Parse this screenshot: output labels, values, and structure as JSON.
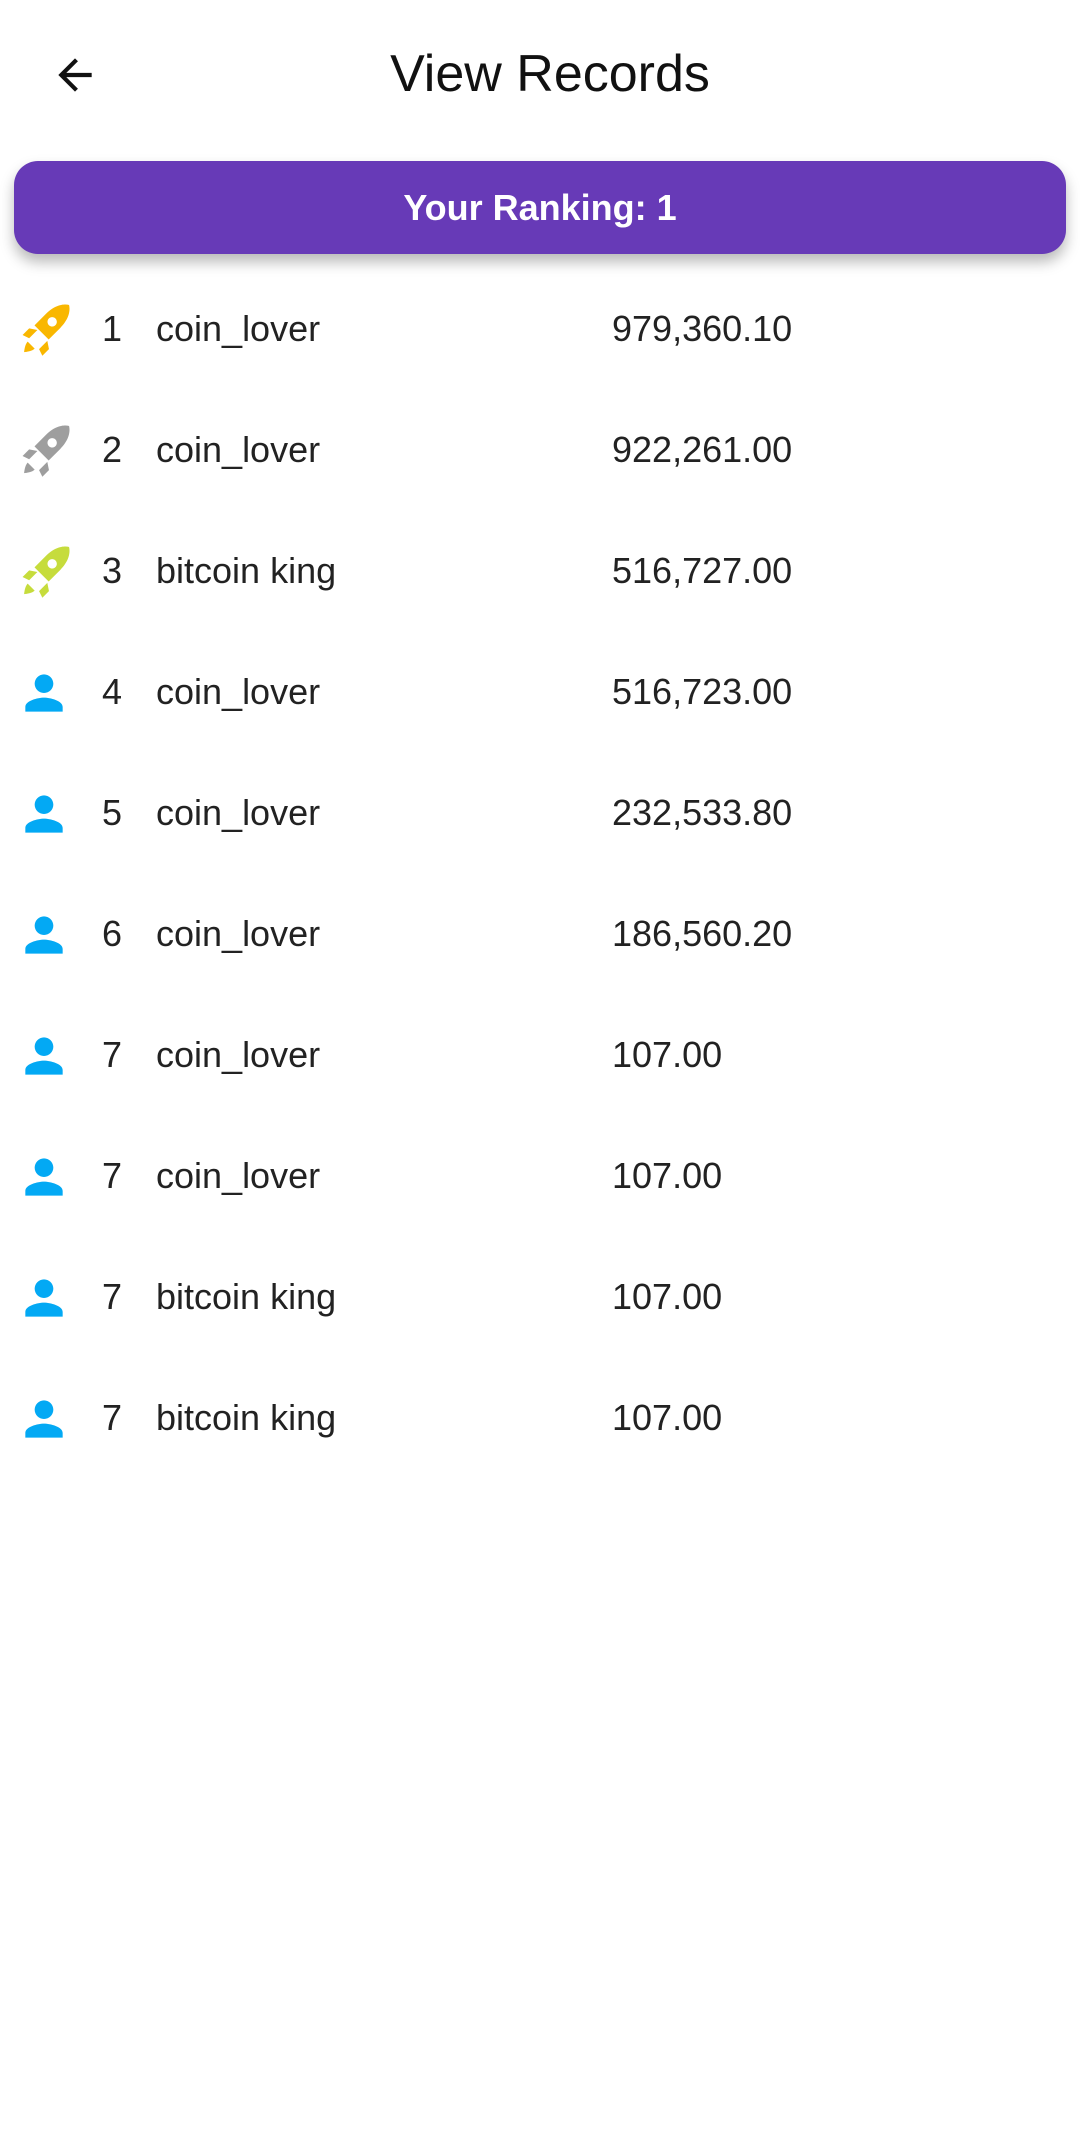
{
  "header": {
    "title": "View Records",
    "back_icon": "arrow-left-icon"
  },
  "ranking_banner": {
    "text": "Your Ranking: 1",
    "color": "#673ab7"
  },
  "records": [
    {
      "rank": "1",
      "name": "coin_lover",
      "score": "979,360.10",
      "icon": "rocket-icon",
      "icon_color": "#f9b700"
    },
    {
      "rank": "2",
      "name": "coin_lover",
      "score": "922,261.00",
      "icon": "rocket-icon",
      "icon_color": "#9e9e9e"
    },
    {
      "rank": "3",
      "name": "bitcoin king",
      "score": "516,727.00",
      "icon": "rocket-icon",
      "icon_color": "#c6dc3c"
    },
    {
      "rank": "4",
      "name": "coin_lover",
      "score": "516,723.00",
      "icon": "person-icon",
      "icon_color": "#03a9f4"
    },
    {
      "rank": "5",
      "name": "coin_lover",
      "score": "232,533.80",
      "icon": "person-icon",
      "icon_color": "#03a9f4"
    },
    {
      "rank": "6",
      "name": "coin_lover",
      "score": "186,560.20",
      "icon": "person-icon",
      "icon_color": "#03a9f4"
    },
    {
      "rank": "7",
      "name": "coin_lover",
      "score": "107.00",
      "icon": "person-icon",
      "icon_color": "#03a9f4"
    },
    {
      "rank": "7",
      "name": "coin_lover",
      "score": "107.00",
      "icon": "person-icon",
      "icon_color": "#03a9f4"
    },
    {
      "rank": "7",
      "name": "bitcoin king",
      "score": "107.00",
      "icon": "person-icon",
      "icon_color": "#03a9f4"
    },
    {
      "rank": "7",
      "name": "bitcoin king",
      "score": "107.00",
      "icon": "person-icon",
      "icon_color": "#03a9f4"
    }
  ]
}
